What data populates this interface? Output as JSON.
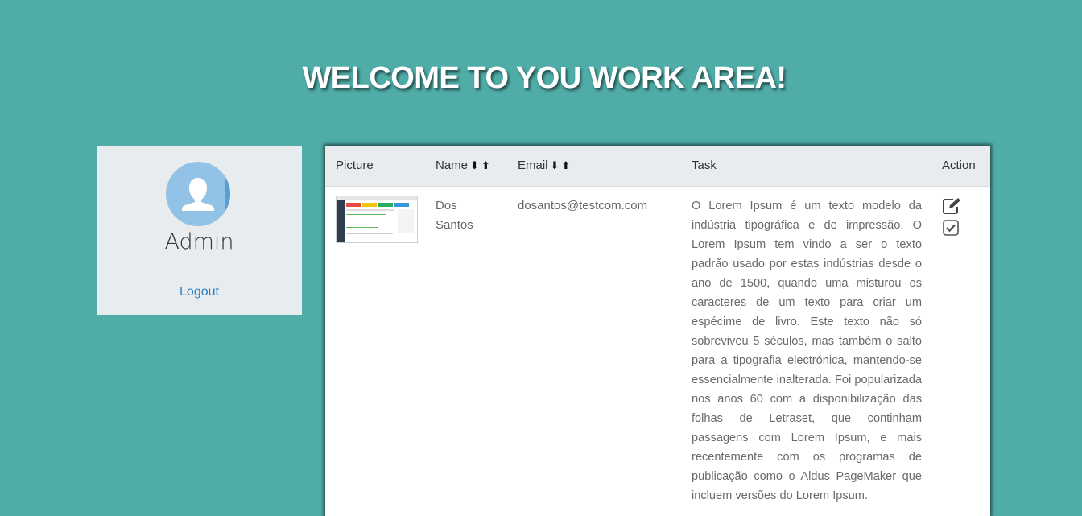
{
  "page": {
    "title": "WELCOME TO YOU WORK AREA!"
  },
  "profile": {
    "name": "Admin",
    "logout_label": "Logout",
    "avatar_icon": "user-icon"
  },
  "table": {
    "columns": {
      "picture": "Picture",
      "name": "Name",
      "email": "Email",
      "task": "Task",
      "action": "Action"
    },
    "sort_down": "⬇",
    "sort_up": "⬆",
    "rows": [
      {
        "name_line1": "Dos",
        "name_line2": "Santos",
        "email": "dosantos@testcom.com",
        "task": "O Lorem Ipsum é um texto modelo da indústria tipográfica e de impressão. O Lorem Ipsum tem vindo a ser o texto padrão usado por estas indústrias desde o ano de 1500, quando uma misturou os caracteres de um texto para criar um espécime de livro. Este texto não só sobreviveu 5 séculos, mas também o salto para a tipografia electrónica, mantendo-se essencialmente inalterada. Foi popularizada nos anos 60 com a disponibilização das folhas de Letraset, que continham passagens com Lorem Ipsum, e mais recentemente com os programas de publicação como o Aldus PageMaker que incluem versões do Lorem Ipsum.",
        "actions": [
          "edit-icon",
          "check-icon"
        ]
      }
    ]
  },
  "colors": {
    "background": "#4faca7",
    "card": "#e8ecee",
    "link": "#2a7fc7",
    "avatar": "#92c2e6"
  }
}
